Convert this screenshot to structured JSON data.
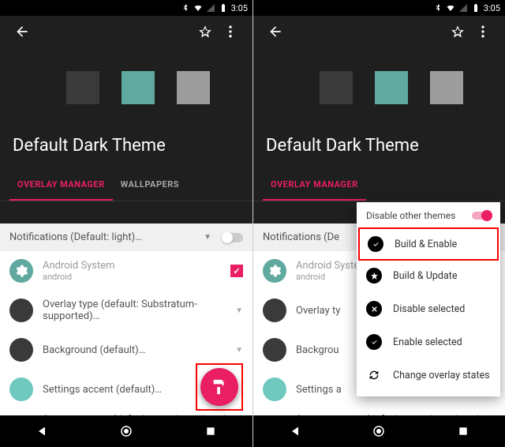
{
  "status": {
    "time": "3:05"
  },
  "theme_title": "Default Dark Theme",
  "tabs": {
    "overlay": "OVERLAY MANAGER",
    "wallpapers": "WALLPAPERS"
  },
  "dropdown": {
    "label": "Notifications (Default: light)…",
    "label_cut": "Notifications (De"
  },
  "rows": {
    "android_system": {
      "title": "Android System",
      "sub": "android"
    },
    "overlay_type": "Overlay type (default: Substratum-supported)…",
    "background": "Background (default)…",
    "settings_accent": "Settings accent (default)…",
    "system_accent_cut": "System accent (default: match settings/",
    "overlay_type_cut": "Overlay ty",
    "background_cut": "Backgrou",
    "settings_accent_cut": "Settings a",
    "system_accent_cut2": "System accent (default: match settings/"
  },
  "popup": {
    "disable_other": "Disable other themes",
    "build_enable": "Build & Enable",
    "build_update": "Build & Update",
    "disable_selected": "Disable selected",
    "enable_selected": "Enable selected",
    "change_states": "Change overlay states"
  }
}
